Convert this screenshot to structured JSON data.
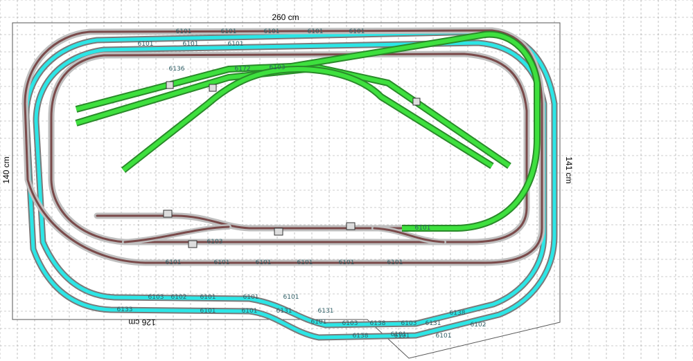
{
  "colors": {
    "grid": "#9a9a9a",
    "brown_track": "#7a4a4a",
    "brown_edge": "#bfbfbf",
    "cyan_track": "#2ce6e6",
    "green_track": "#3ee03e",
    "green_edge": "#2a8a2a",
    "outline": "#555555"
  },
  "dimensions": {
    "top": "260 cm",
    "left": "140 cm",
    "right": "141 cm",
    "bottom": "126 cm"
  },
  "track_labels": [
    "6101",
    "6101",
    "6101",
    "6101",
    "6101",
    "6101",
    "6101",
    "6101",
    "6103",
    "6102",
    "6101",
    "6101",
    "6101",
    "6131",
    "6133",
    "6101",
    "6101",
    "6101",
    "6131",
    "6101",
    "6138",
    "6103",
    "6131",
    "6138",
    "6101",
    "6138",
    "6102",
    "6101",
    "6103",
    "6101",
    "6101",
    "6101",
    "6101",
    "6101",
    "6101",
    "6103",
    "6101",
    "6136",
    "6172",
    "6103"
  ]
}
